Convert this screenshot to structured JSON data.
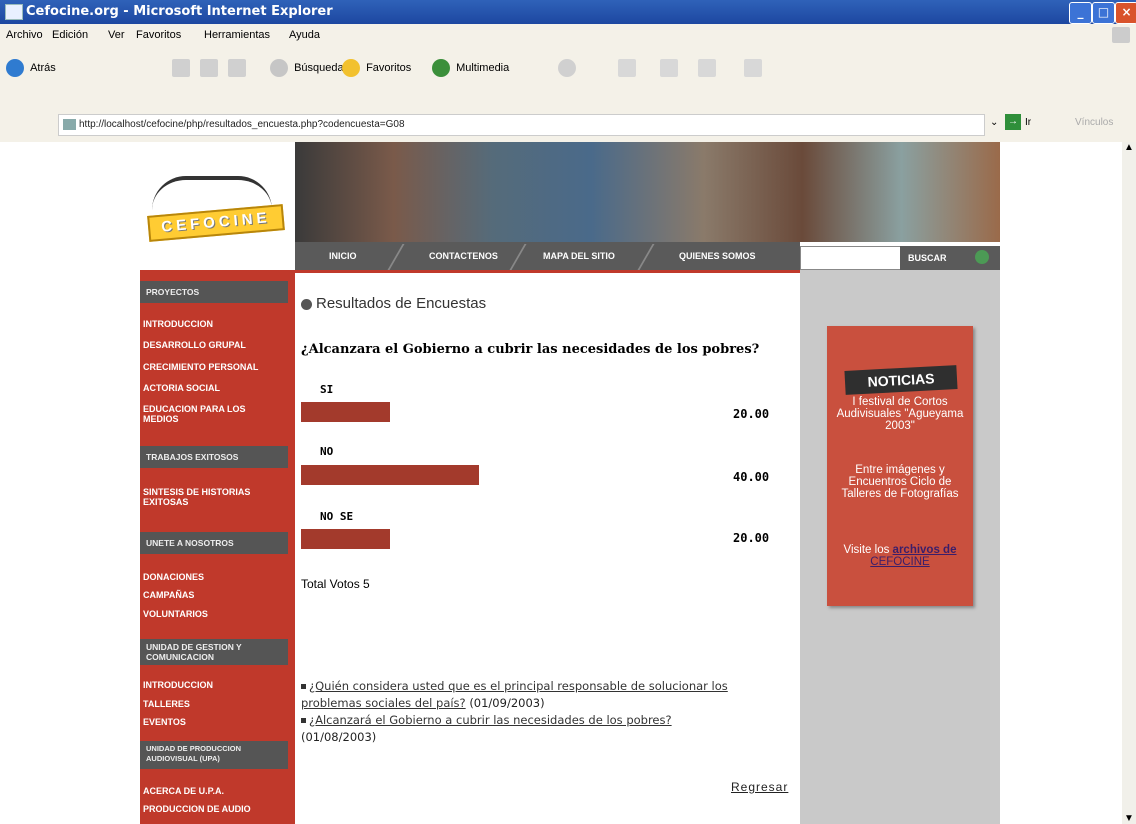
{
  "window": {
    "title": "Cefocine.org - Microsoft Internet Explorer",
    "controls": [
      "_",
      "□",
      "×"
    ]
  },
  "menu": [
    "Archivo",
    "Edición",
    "Ver",
    "Favoritos",
    "Herramientas",
    "Ayuda"
  ],
  "toolbar": {
    "back": "Atrás",
    "search": "Búsqueda",
    "favorites": "Favoritos",
    "media": "Multimedia"
  },
  "address": {
    "url": "http://localhost/cefocine/php/resultados_encuesta.php?codencuesta=G08",
    "go": "Ir",
    "links": "Vínculos"
  },
  "logo_text": "CEFOCINE",
  "nav": [
    "INICIO",
    "CONTACTENOS",
    "MAPA DEL SITIO",
    "QUIENES SOMOS"
  ],
  "search": {
    "button": "BUSCAR"
  },
  "sidebar": {
    "sections": [
      {
        "head": "PROYECTOS",
        "items": [
          "INTRODUCCION",
          "DESARROLLO GRUPAL",
          "CRECIMIENTO  PERSONAL",
          "ACTORIA SOCIAL",
          "EDUCACION PARA LOS MEDIOS"
        ]
      },
      {
        "head": "TRABAJOS EXITOSOS",
        "items": [
          "SINTESIS DE HISTORIAS EXITOSAS"
        ]
      },
      {
        "head": "UNETE A NOSOTROS",
        "items": [
          "DONACIONES",
          "CAMPAÑAS",
          "VOLUNTARIOS"
        ]
      },
      {
        "head": "UNIDAD DE GESTION Y COMUNICACION",
        "items": [
          "INTRODUCCION",
          "TALLERES",
          "EVENTOS"
        ]
      },
      {
        "head": "UNIDAD DE PRODUCCION AUDIOVISUAL (UPA)",
        "items": [
          "ACERCA DE U.P.A.",
          "PRODUCCION DE AUDIO"
        ]
      }
    ]
  },
  "main": {
    "title": "Resultados de Encuestas",
    "question": "¿Alcanzara el Gobierno a cubrir las necesidades de los pobres?",
    "options": [
      {
        "label": "SI",
        "value": "20.00",
        "percent": 20
      },
      {
        "label": "NO",
        "value": "40.00",
        "percent": 40
      },
      {
        "label": "NO SE",
        "value": "20.00",
        "percent": 20
      }
    ],
    "total": "Total Votos 5",
    "other_polls": [
      {
        "text": "¿Quién considera usted que es el principal responsable de solucionar los problemas sociales del país?",
        "date": "(01/09/2003)"
      },
      {
        "text": "¿Alcanzará el Gobierno a cubrir las necesidades de los pobres?",
        "date": "(01/08/2003)"
      }
    ],
    "back": "Regresar"
  },
  "news": {
    "title": "NOTICIAS",
    "item1": "I festival de Cortos Audivisuales \"Agueyama 2003\"",
    "item2": "Entre imágenes y Encuentros Ciclo de Talleres de Fotografías",
    "visit_prefix": "Visite los",
    "visit_link_a": "archivos de",
    "visit_link_b": "CEFOCINE"
  }
}
